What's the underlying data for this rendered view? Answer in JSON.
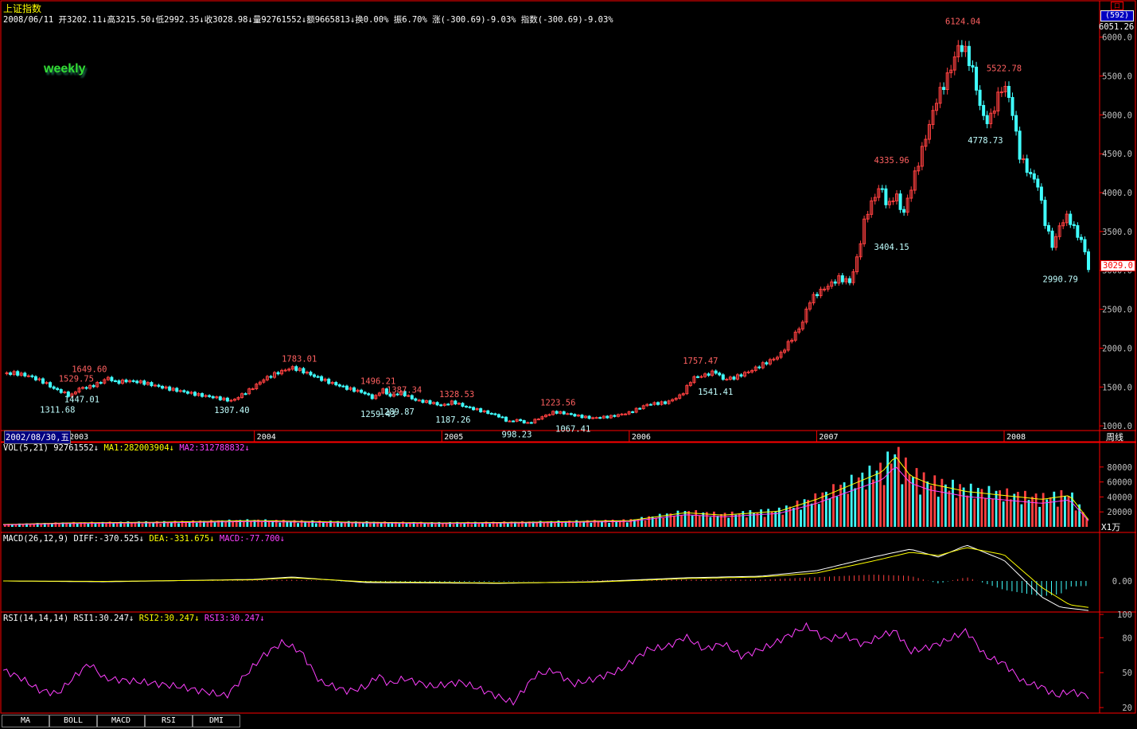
{
  "header": {
    "title": "上证指数",
    "info": "2008/06/11 开3202.11↓高3215.50↓低2992.35↓收3028.98↓量92761552↓额9665813↓换0.00% 振6.70% 涨(-300.69)-9.03% 指数(-300.69)-9.03%",
    "period_tag": "weekly",
    "top_box": "口",
    "badge_count": "(592)",
    "badge_top_value": "6051.26",
    "current_price_tag": "3029.0"
  },
  "time_axis": {
    "cursor_date": "2002/08/30,五",
    "period_label": "周线",
    "years": [
      "2003",
      "2004",
      "2005",
      "2006",
      "2007",
      "2008"
    ]
  },
  "indicators": {
    "vol": {
      "name": "VOL(5,21)",
      "value": "92761552↓",
      "ma1": "MA1:282003904↓",
      "ma2": "MA2:312788832↓",
      "unit": "X1万"
    },
    "macd": {
      "name": "MACD(26,12,9)",
      "diff": "DIFF:-370.525↓",
      "dea": "DEA:-331.675↓",
      "macd": "MACD:-77.700↓"
    },
    "rsi": {
      "name": "RSI(14,14,14)",
      "rsi1": "RSI1:30.247↓",
      "rsi2": "RSI2:30.247↓",
      "rsi3": "RSI3:30.247↓"
    }
  },
  "tabs": [
    "MA",
    "BOLL",
    "MACD",
    "RSI",
    "DMI"
  ],
  "colors": {
    "up": "#ff4040",
    "down": "#40ffff",
    "ma1": "#ffff00",
    "ma2": "#ff40ff",
    "grid": "#ff0000",
    "axis_text": "#c0c0c0"
  },
  "chart_data": {
    "type": "candlestick",
    "title": "上证指数 weekly",
    "price_axis": {
      "ticks": [
        1000,
        1500,
        2000,
        2500,
        3000,
        3500,
        4000,
        4500,
        5000,
        5500,
        6000
      ],
      "tick_labels": [
        "1000.0",
        "1500.0",
        "2000.0",
        "2500.0",
        "3000.0",
        "3500.0",
        "4000.0",
        "4500.0",
        "5000.0",
        "5500.0",
        "6000.0"
      ],
      "range": [
        950,
        6150
      ]
    },
    "x_range_years": [
      2002.66,
      2008.45
    ],
    "price_path": [
      [
        2002.66,
        1670
      ],
      [
        2002.72,
        1680
      ],
      [
        2002.8,
        1640
      ],
      [
        2002.88,
        1560
      ],
      [
        2002.93,
        1480
      ],
      [
        2002.98,
        1430
      ],
      [
        2003.02,
        1380
      ],
      [
        2003.06,
        1480
      ],
      [
        2003.12,
        1500
      ],
      [
        2003.18,
        1560
      ],
      [
        2003.22,
        1620
      ],
      [
        2003.26,
        1560
      ],
      [
        2003.32,
        1580
      ],
      [
        2003.4,
        1560
      ],
      [
        2003.5,
        1500
      ],
      [
        2003.6,
        1450
      ],
      [
        2003.7,
        1400
      ],
      [
        2003.8,
        1360
      ],
      [
        2003.88,
        1320
      ],
      [
        2003.92,
        1380
      ],
      [
        2003.98,
        1470
      ],
      [
        2004.05,
        1600
      ],
      [
        2004.12,
        1680
      ],
      [
        2004.2,
        1750
      ],
      [
        2004.24,
        1720
      ],
      [
        2004.32,
        1640
      ],
      [
        2004.4,
        1560
      ],
      [
        2004.5,
        1480
      ],
      [
        2004.58,
        1430
      ],
      [
        2004.64,
        1350
      ],
      [
        2004.68,
        1480
      ],
      [
        2004.72,
        1380
      ],
      [
        2004.78,
        1430
      ],
      [
        2004.86,
        1330
      ],
      [
        2004.94,
        1300
      ],
      [
        2005.0,
        1260
      ],
      [
        2005.06,
        1310
      ],
      [
        2005.12,
        1250
      ],
      [
        2005.2,
        1200
      ],
      [
        2005.3,
        1130
      ],
      [
        2005.36,
        1050
      ],
      [
        2005.4,
        1080
      ],
      [
        2005.46,
        1030
      ],
      [
        2005.52,
        1100
      ],
      [
        2005.6,
        1180
      ],
      [
        2005.66,
        1160
      ],
      [
        2005.72,
        1130
      ],
      [
        2005.8,
        1100
      ],
      [
        2005.9,
        1120
      ],
      [
        2006.0,
        1170
      ],
      [
        2006.1,
        1280
      ],
      [
        2006.2,
        1300
      ],
      [
        2006.28,
        1400
      ],
      [
        2006.34,
        1620
      ],
      [
        2006.4,
        1650
      ],
      [
        2006.46,
        1700
      ],
      [
        2006.5,
        1600
      ],
      [
        2006.56,
        1620
      ],
      [
        2006.64,
        1700
      ],
      [
        2006.72,
        1800
      ],
      [
        2006.8,
        1900
      ],
      [
        2006.86,
        2100
      ],
      [
        2006.92,
        2300
      ],
      [
        2006.96,
        2600
      ],
      [
        2007.0,
        2700
      ],
      [
        2007.06,
        2800
      ],
      [
        2007.12,
        2900
      ],
      [
        2007.18,
        2850
      ],
      [
        2007.22,
        3200
      ],
      [
        2007.26,
        3700
      ],
      [
        2007.3,
        3900
      ],
      [
        2007.34,
        4100
      ],
      [
        2007.38,
        3800
      ],
      [
        2007.42,
        4000
      ],
      [
        2007.46,
        3700
      ],
      [
        2007.52,
        4200
      ],
      [
        2007.58,
        4700
      ],
      [
        2007.64,
        5200
      ],
      [
        2007.7,
        5500
      ],
      [
        2007.76,
        5900
      ],
      [
        2007.8,
        5800
      ],
      [
        2007.84,
        5500
      ],
      [
        2007.88,
        5000
      ],
      [
        2007.92,
        4900
      ],
      [
        2007.96,
        5200
      ],
      [
        2008.0,
        5400
      ],
      [
        2008.04,
        5100
      ],
      [
        2008.08,
        4500
      ],
      [
        2008.12,
        4300
      ],
      [
        2008.18,
        4100
      ],
      [
        2008.22,
        3600
      ],
      [
        2008.26,
        3300
      ],
      [
        2008.3,
        3600
      ],
      [
        2008.34,
        3700
      ],
      [
        2008.38,
        3500
      ],
      [
        2008.42,
        3350
      ],
      [
        2008.45,
        3029
      ]
    ],
    "annotations": [
      {
        "label": "1311.68",
        "x": 2002.95,
        "price": 1311.68,
        "pos": "below"
      },
      {
        "label": "1529.75",
        "x": 2003.05,
        "price": 1529.75,
        "pos": "above"
      },
      {
        "label": "1447.01",
        "x": 2003.08,
        "price": 1447.01,
        "pos": "below"
      },
      {
        "label": "1649.60",
        "x": 2003.12,
        "price": 1649.6,
        "pos": "above"
      },
      {
        "label": "1307.40",
        "x": 2003.88,
        "price": 1307.4,
        "pos": "below"
      },
      {
        "label": "1783.01",
        "x": 2004.24,
        "price": 1783.01,
        "pos": "above"
      },
      {
        "label": "1496.21",
        "x": 2004.66,
        "price": 1496.21,
        "pos": "above"
      },
      {
        "label": "1259.43",
        "x": 2004.66,
        "price": 1259.43,
        "pos": "below"
      },
      {
        "label": "1289.87",
        "x": 2004.76,
        "price": 1289.87,
        "pos": "below"
      },
      {
        "label": "1387.34",
        "x": 2004.8,
        "price": 1387.34,
        "pos": "above"
      },
      {
        "label": "1328.53",
        "x": 2005.08,
        "price": 1328.53,
        "pos": "above"
      },
      {
        "label": "1187.26",
        "x": 2005.06,
        "price": 1187.26,
        "pos": "below"
      },
      {
        "label": "998.23",
        "x": 2005.4,
        "price": 998.23,
        "pos": "below"
      },
      {
        "label": "1223.56",
        "x": 2005.62,
        "price": 1223.56,
        "pos": "above"
      },
      {
        "label": "1067.41",
        "x": 2005.7,
        "price": 1067.41,
        "pos": "below"
      },
      {
        "label": "1757.47",
        "x": 2006.38,
        "price": 1757.47,
        "pos": "above"
      },
      {
        "label": "1541.41",
        "x": 2006.46,
        "price": 1541.41,
        "pos": "below"
      },
      {
        "label": "4335.96",
        "x": 2007.4,
        "price": 4335.96,
        "pos": "above"
      },
      {
        "label": "3404.15",
        "x": 2007.4,
        "price": 3404.15,
        "pos": "below"
      },
      {
        "label": "6124.04",
        "x": 2007.78,
        "price": 6124.04,
        "pos": "above"
      },
      {
        "label": "4778.73",
        "x": 2007.9,
        "price": 4778.73,
        "pos": "below"
      },
      {
        "label": "5522.78",
        "x": 2008.0,
        "price": 5522.78,
        "pos": "above"
      },
      {
        "label": "2990.79",
        "x": 2008.3,
        "price": 2990.79,
        "pos": "below"
      }
    ],
    "volume_axis": {
      "ticks": [
        20000,
        40000,
        60000,
        80000
      ],
      "tick_labels": [
        "20000",
        "40000",
        "60000",
        "80000"
      ],
      "range": [
        0,
        100000
      ]
    },
    "volume_path": [
      [
        2002.66,
        3000
      ],
      [
        2003.0,
        5000
      ],
      [
        2003.5,
        6000
      ],
      [
        2004.0,
        8000
      ],
      [
        2004.5,
        6000
      ],
      [
        2005.0,
        5000
      ],
      [
        2005.5,
        6000
      ],
      [
        2006.0,
        8000
      ],
      [
        2006.3,
        18000
      ],
      [
        2006.5,
        15000
      ],
      [
        2006.8,
        20000
      ],
      [
        2007.0,
        35000
      ],
      [
        2007.2,
        55000
      ],
      [
        2007.35,
        70000
      ],
      [
        2007.42,
        90000
      ],
      [
        2007.5,
        65000
      ],
      [
        2007.6,
        55000
      ],
      [
        2007.8,
        45000
      ],
      [
        2008.0,
        40000
      ],
      [
        2008.2,
        35000
      ],
      [
        2008.35,
        40000
      ],
      [
        2008.45,
        9000
      ]
    ],
    "macd_axis": {
      "ticks": [
        0
      ],
      "tick_labels": [
        "0.00"
      ],
      "range": [
        -380,
        500
      ]
    },
    "macd_diff_path": [
      [
        2002.66,
        0
      ],
      [
        2003.2,
        -10
      ],
      [
        2004.0,
        20
      ],
      [
        2004.2,
        50
      ],
      [
        2004.6,
        -20
      ],
      [
        2005.3,
        -30
      ],
      [
        2005.8,
        -10
      ],
      [
        2006.3,
        40
      ],
      [
        2006.7,
        60
      ],
      [
        2007.0,
        130
      ],
      [
        2007.3,
        300
      ],
      [
        2007.5,
        400
      ],
      [
        2007.65,
        300
      ],
      [
        2007.8,
        450
      ],
      [
        2008.0,
        260
      ],
      [
        2008.2,
        -200
      ],
      [
        2008.3,
        -330
      ],
      [
        2008.45,
        -370.525
      ]
    ],
    "macd_dea_path": [
      [
        2002.66,
        0
      ],
      [
        2003.2,
        -5
      ],
      [
        2004.0,
        15
      ],
      [
        2004.2,
        40
      ],
      [
        2004.6,
        -10
      ],
      [
        2005.3,
        -25
      ],
      [
        2005.8,
        -15
      ],
      [
        2006.3,
        30
      ],
      [
        2006.7,
        50
      ],
      [
        2007.0,
        100
      ],
      [
        2007.3,
        250
      ],
      [
        2007.5,
        360
      ],
      [
        2007.65,
        320
      ],
      [
        2007.8,
        420
      ],
      [
        2008.0,
        330
      ],
      [
        2008.2,
        -80
      ],
      [
        2008.35,
        -300
      ],
      [
        2008.45,
        -331.675
      ]
    ],
    "rsi_axis": {
      "ticks": [
        20,
        50,
        80,
        100
      ],
      "tick_labels": [
        "20",
        "50",
        "80",
        "100"
      ],
      "range": [
        18,
        100
      ]
    },
    "rsi_path": [
      [
        2002.66,
        52
      ],
      [
        2002.75,
        46
      ],
      [
        2002.85,
        35
      ],
      [
        2002.95,
        32
      ],
      [
        2003.05,
        48
      ],
      [
        2003.12,
        58
      ],
      [
        2003.2,
        45
      ],
      [
        2003.4,
        42
      ],
      [
        2003.6,
        38
      ],
      [
        2003.85,
        30
      ],
      [
        2004.05,
        65
      ],
      [
        2004.15,
        76
      ],
      [
        2004.25,
        68
      ],
      [
        2004.35,
        42
      ],
      [
        2004.5,
        34
      ],
      [
        2004.6,
        38
      ],
      [
        2004.66,
        48
      ],
      [
        2004.72,
        40
      ],
      [
        2004.8,
        45
      ],
      [
        2004.95,
        38
      ],
      [
        2005.1,
        42
      ],
      [
        2005.25,
        33
      ],
      [
        2005.38,
        24
      ],
      [
        2005.5,
        48
      ],
      [
        2005.6,
        52
      ],
      [
        2005.7,
        40
      ],
      [
        2005.8,
        44
      ],
      [
        2005.95,
        52
      ],
      [
        2006.1,
        70
      ],
      [
        2006.2,
        72
      ],
      [
        2006.3,
        81
      ],
      [
        2006.4,
        70
      ],
      [
        2006.5,
        75
      ],
      [
        2006.6,
        64
      ],
      [
        2006.75,
        73
      ],
      [
        2006.85,
        82
      ],
      [
        2006.95,
        90
      ],
      [
        2007.05,
        78
      ],
      [
        2007.15,
        82
      ],
      [
        2007.25,
        74
      ],
      [
        2007.35,
        82
      ],
      [
        2007.42,
        86
      ],
      [
        2007.5,
        68
      ],
      [
        2007.6,
        72
      ],
      [
        2007.7,
        78
      ],
      [
        2007.8,
        86
      ],
      [
        2007.9,
        64
      ],
      [
        2008.0,
        58
      ],
      [
        2008.1,
        42
      ],
      [
        2008.2,
        38
      ],
      [
        2008.28,
        30
      ],
      [
        2008.35,
        34
      ],
      [
        2008.45,
        30.247
      ]
    ]
  }
}
